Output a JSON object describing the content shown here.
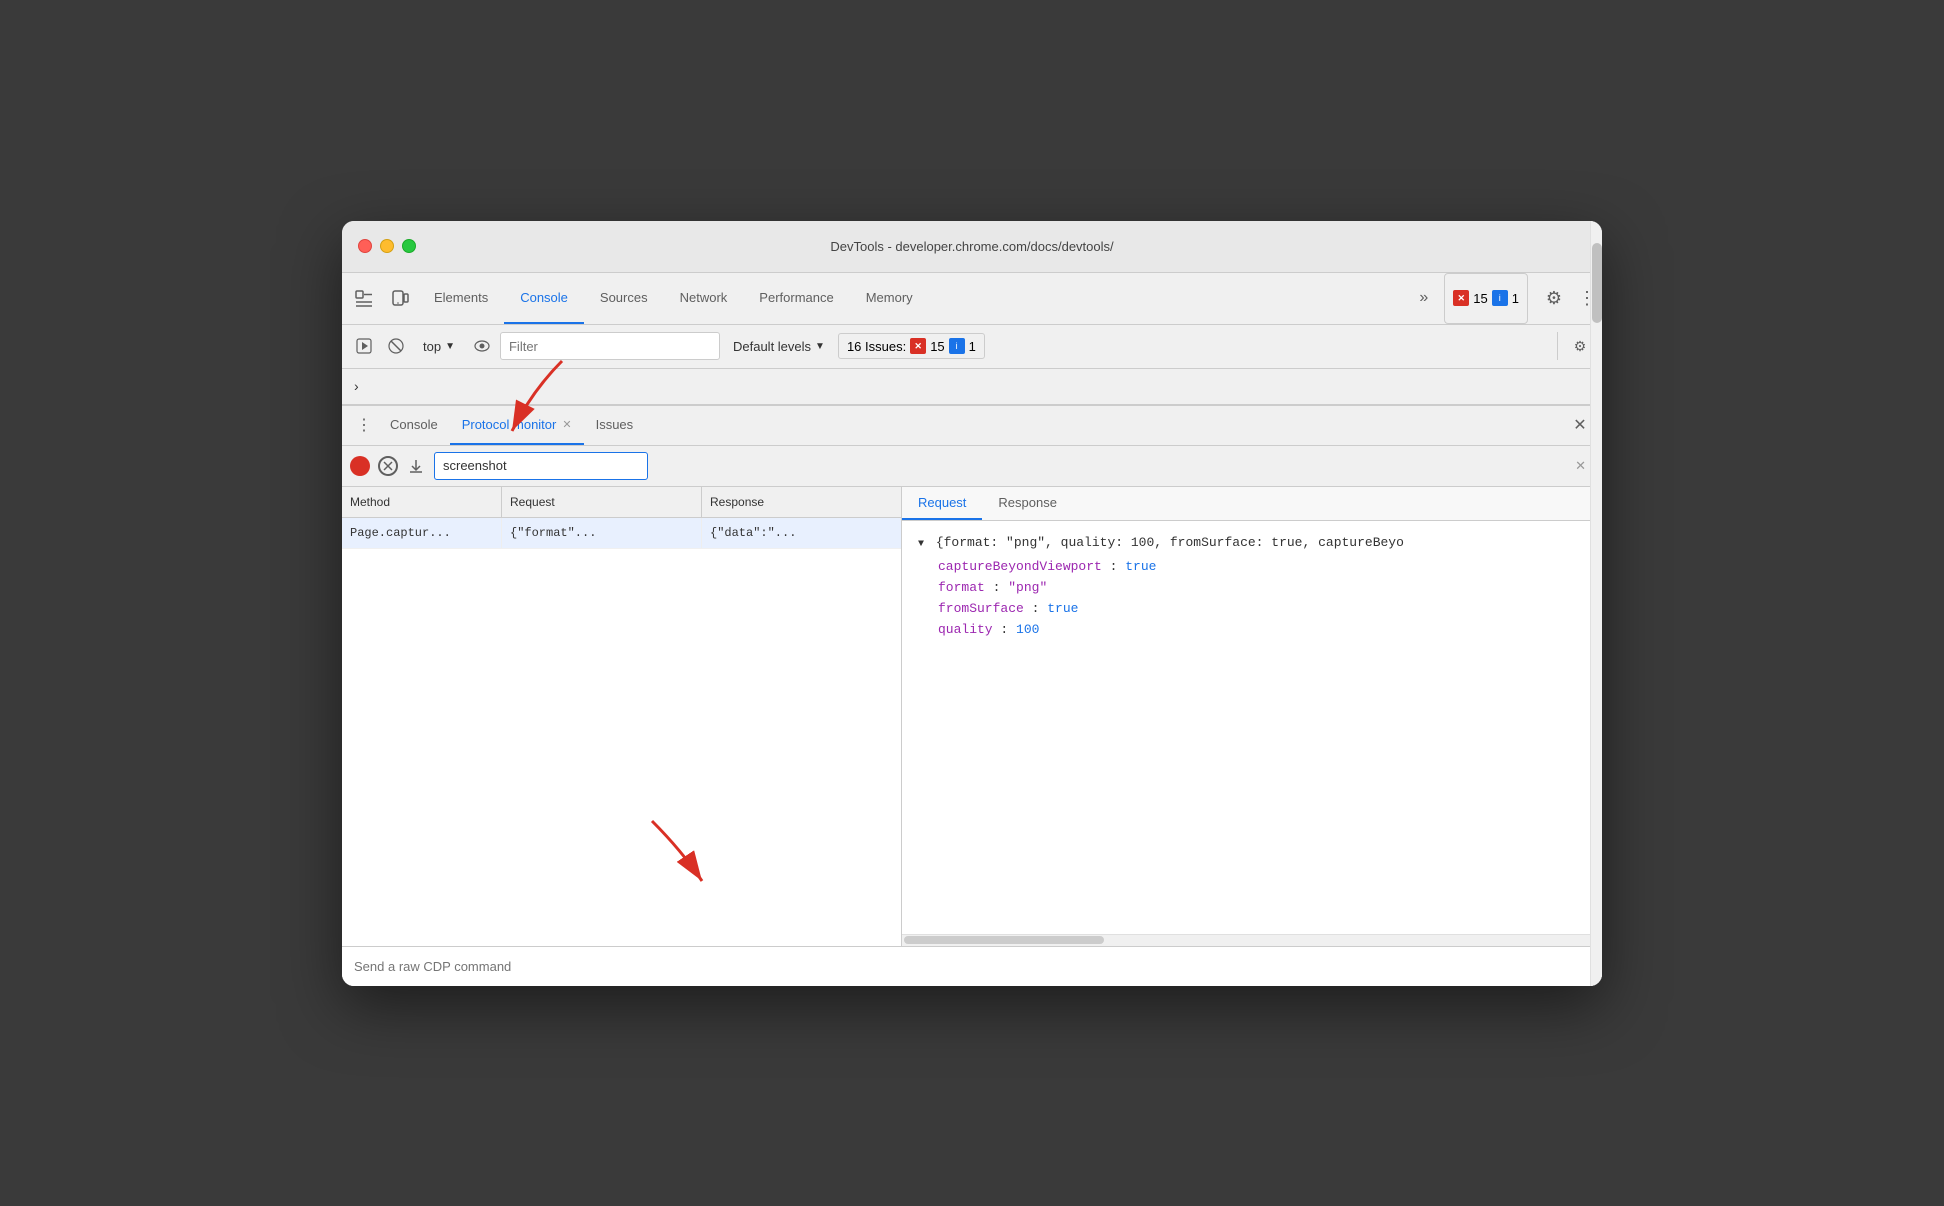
{
  "window": {
    "title": "DevTools - developer.chrome.com/docs/devtools/"
  },
  "traffic_lights": {
    "red_label": "close",
    "yellow_label": "minimize",
    "green_label": "maximize"
  },
  "main_tabs": {
    "inspect_icon": "⬚",
    "device_icon": "📱",
    "items": [
      {
        "id": "elements",
        "label": "Elements",
        "active": false
      },
      {
        "id": "console",
        "label": "Console",
        "active": true
      },
      {
        "id": "sources",
        "label": "Sources",
        "active": false
      },
      {
        "id": "network",
        "label": "Network",
        "active": false
      },
      {
        "id": "performance",
        "label": "Performance",
        "active": false
      },
      {
        "id": "memory",
        "label": "Memory",
        "active": false
      }
    ],
    "overflow_label": "»",
    "error_count": "15",
    "info_count": "1",
    "settings_icon": "⚙",
    "more_icon": "⋮"
  },
  "console_toolbar": {
    "run_icon": "▶",
    "clear_icon": "🚫",
    "top_label": "top",
    "eye_icon": "👁",
    "filter_placeholder": "Filter",
    "default_levels_label": "Default levels",
    "dropdown_icon": "▼",
    "issues_label": "16 Issues:",
    "error_count": "15",
    "info_count": "1",
    "settings_icon": "⚙"
  },
  "breadcrumb": {
    "chevron": "›"
  },
  "drawer": {
    "more_icon": "⋮",
    "tabs": [
      {
        "id": "console",
        "label": "Console",
        "closeable": false,
        "active": false
      },
      {
        "id": "protocol-monitor",
        "label": "Protocol monitor",
        "closeable": true,
        "active": true
      },
      {
        "id": "issues",
        "label": "Issues",
        "closeable": false,
        "active": false
      }
    ],
    "close_icon": "✕"
  },
  "protocol_monitor": {
    "record_icon": "●",
    "clear_icon": "⊘",
    "download_icon": "↓",
    "search_value": "screenshot",
    "search_clear": "✕",
    "table": {
      "columns": [
        {
          "id": "method",
          "label": "Method"
        },
        {
          "id": "request",
          "label": "Request"
        },
        {
          "id": "response",
          "label": "Response"
        }
      ],
      "rows": [
        {
          "method": "Page.captur...",
          "request": "{\"format\"...",
          "response": "{\"data\":\"..."
        }
      ]
    },
    "detail_tabs": [
      {
        "id": "request",
        "label": "Request",
        "active": true
      },
      {
        "id": "response",
        "label": "Response",
        "active": false
      }
    ],
    "detail_json": {
      "summary": "{format: \"png\", quality: 100, fromSurface: true, captureBeyо",
      "fields": [
        {
          "key": "captureBeyondViewport",
          "value": "true",
          "type": "bool"
        },
        {
          "key": "format",
          "value": "\"png\"",
          "type": "string"
        },
        {
          "key": "fromSurface",
          "value": "true",
          "type": "bool"
        },
        {
          "key": "quality",
          "value": "100",
          "type": "number"
        }
      ]
    }
  },
  "bottom_bar": {
    "placeholder": "Send a raw CDP command"
  }
}
